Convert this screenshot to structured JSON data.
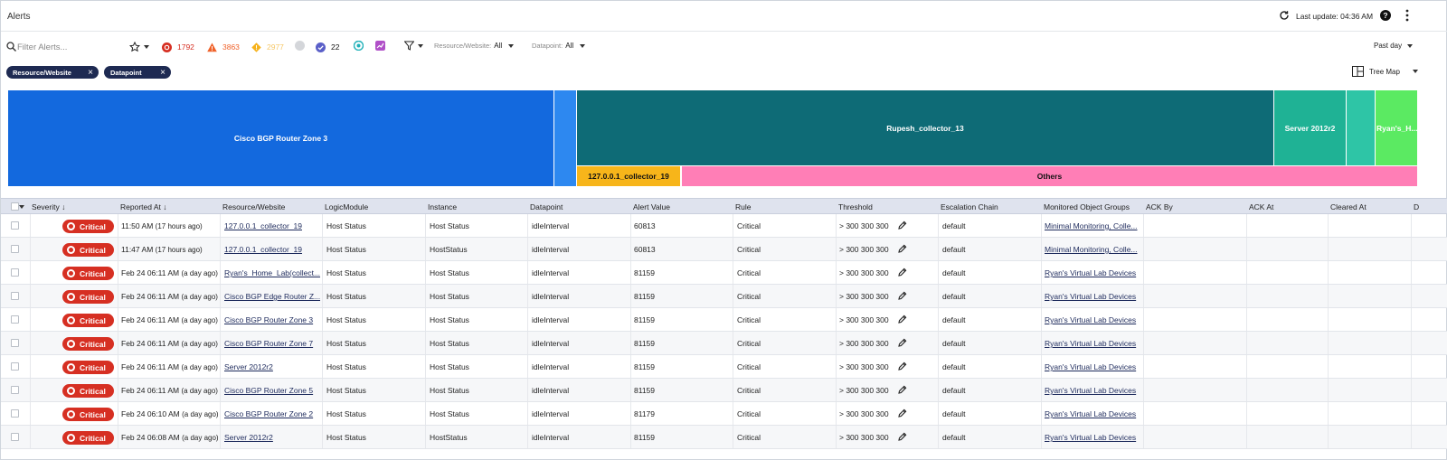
{
  "header": {
    "title": "Alerts",
    "last_update": "Last update: 04:36 AM",
    "help_glyph": "?"
  },
  "filters": {
    "search_placeholder": "Filter Alerts...",
    "counts": {
      "critical": "1792",
      "error": "3863",
      "warning": "2977",
      "other": "22"
    },
    "resource_label": "Resource/Website:",
    "resource_value": "All",
    "datapoint_label": "Datapoint:",
    "datapoint_value": "All",
    "timerange": "Past day"
  },
  "chips": [
    {
      "label": "Resource/Website",
      "remove": "×"
    },
    {
      "label": "Datapoint",
      "remove": "×"
    }
  ],
  "view": {
    "label": "Tree Map"
  },
  "treemap": [
    {
      "label": "Cisco BGP Router Zone 3",
      "color": "#1369de"
    },
    {
      "label": "",
      "color": "#2d88f0"
    },
    {
      "label": "Rupesh_collector_13",
      "color": "#0e6b76"
    },
    {
      "label": "127.0.0.1_collector_19",
      "color": "#f7b51a"
    },
    {
      "label": "Others",
      "color": "#ff7eb6"
    },
    {
      "label": "Server 2012r2",
      "color": "#1fb295"
    },
    {
      "label": "",
      "color": "#2ec5a6"
    },
    {
      "label": "Ryan's_H...",
      "color": "#5bea62"
    }
  ],
  "table": {
    "columns": [
      "Severity",
      "Reported At",
      "Resource/Website",
      "LogicModule",
      "Instance",
      "Datapoint",
      "Alert Value",
      "Rule",
      "Threshold",
      "Escalation Chain",
      "Monitored Object Groups",
      "ACK By",
      "ACK At",
      "Cleared At",
      "D"
    ],
    "sort_arrow": "↓",
    "rows": [
      {
        "severity": "Critical",
        "reported": "11:50 AM",
        "ago": "(17 hours ago)",
        "resource": "127.0.0.1_collector_19",
        "module": "Host Status",
        "instance": "Host Status",
        "datapoint": "idleInterval",
        "value": "60813",
        "rule": "Critical",
        "threshold": "> 300 300 300",
        "chain": "default",
        "groups": "Minimal Monitoring, Colle..."
      },
      {
        "severity": "Critical",
        "reported": "11:47 AM",
        "ago": "(17 hours ago)",
        "resource": "127.0.0.1_collector_19",
        "module": "Host Status",
        "instance": "HostStatus",
        "datapoint": "idleInterval",
        "value": "60813",
        "rule": "Critical",
        "threshold": "> 300 300 300",
        "chain": "default",
        "groups": "Minimal Monitoring, Colle..."
      },
      {
        "severity": "Critical",
        "reported": "Feb 24 06:11 AM",
        "ago": "(a day ago)",
        "resource": "Ryan's_Home_Lab(collect...",
        "module": "Host Status",
        "instance": "Host Status",
        "datapoint": "idleInterval",
        "value": "81159",
        "rule": "Critical",
        "threshold": "> 300 300 300",
        "chain": "default",
        "groups": "Ryan's Virtual Lab Devices"
      },
      {
        "severity": "Critical",
        "reported": "Feb 24 06:11 AM",
        "ago": "(a day ago)",
        "resource": "Cisco BGP Edge Router Z...",
        "module": "Host Status",
        "instance": "Host Status",
        "datapoint": "idleInterval",
        "value": "81159",
        "rule": "Critical",
        "threshold": "> 300 300 300",
        "chain": "default",
        "groups": "Ryan's Virtual Lab Devices"
      },
      {
        "severity": "Critical",
        "reported": "Feb 24 06:11 AM",
        "ago": "(a day ago)",
        "resource": "Cisco BGP Router Zone 3",
        "module": "Host Status",
        "instance": "Host Status",
        "datapoint": "idleInterval",
        "value": "81159",
        "rule": "Critical",
        "threshold": "> 300 300 300",
        "chain": "default",
        "groups": "Ryan's Virtual Lab Devices"
      },
      {
        "severity": "Critical",
        "reported": "Feb 24 06:11 AM",
        "ago": "(a day ago)",
        "resource": "Cisco BGP Router Zone 7",
        "module": "Host Status",
        "instance": "Host Status",
        "datapoint": "idleInterval",
        "value": "81159",
        "rule": "Critical",
        "threshold": "> 300 300 300",
        "chain": "default",
        "groups": "Ryan's Virtual Lab Devices"
      },
      {
        "severity": "Critical",
        "reported": "Feb 24 06:11 AM",
        "ago": "(a day ago)",
        "resource": "Server 2012r2",
        "module": "Host Status",
        "instance": "Host Status",
        "datapoint": "idleInterval",
        "value": "81159",
        "rule": "Critical",
        "threshold": "> 300 300 300",
        "chain": "default",
        "groups": "Ryan's Virtual Lab Devices"
      },
      {
        "severity": "Critical",
        "reported": "Feb 24 06:11 AM",
        "ago": "(a day ago)",
        "resource": "Cisco BGP Router Zone 5",
        "module": "Host Status",
        "instance": "Host Status",
        "datapoint": "idleInterval",
        "value": "81159",
        "rule": "Critical",
        "threshold": "> 300 300 300",
        "chain": "default",
        "groups": "Ryan's Virtual Lab Devices"
      },
      {
        "severity": "Critical",
        "reported": "Feb 24 06:10 AM",
        "ago": "(a day ago)",
        "resource": "Cisco BGP Router Zone 2",
        "module": "Host Status",
        "instance": "Host Status",
        "datapoint": "idleInterval",
        "value": "81179",
        "rule": "Critical",
        "threshold": "> 300 300 300",
        "chain": "default",
        "groups": "Ryan's Virtual Lab Devices"
      },
      {
        "severity": "Critical",
        "reported": "Feb 24 06:08 AM",
        "ago": "(a day ago)",
        "resource": "Server 2012r2",
        "module": "Host Status",
        "instance": "HostStatus",
        "datapoint": "idleInterval",
        "value": "81159",
        "rule": "Critical",
        "threshold": "> 300 300 300",
        "chain": "default",
        "groups": "Ryan's Virtual Lab Devices"
      }
    ]
  },
  "colors": {
    "critical": "#d62f22",
    "error": "#f0622a",
    "warning": "#f6b21c",
    "chip": "#1e2a52",
    "header_bg": "#dfe3ee"
  }
}
